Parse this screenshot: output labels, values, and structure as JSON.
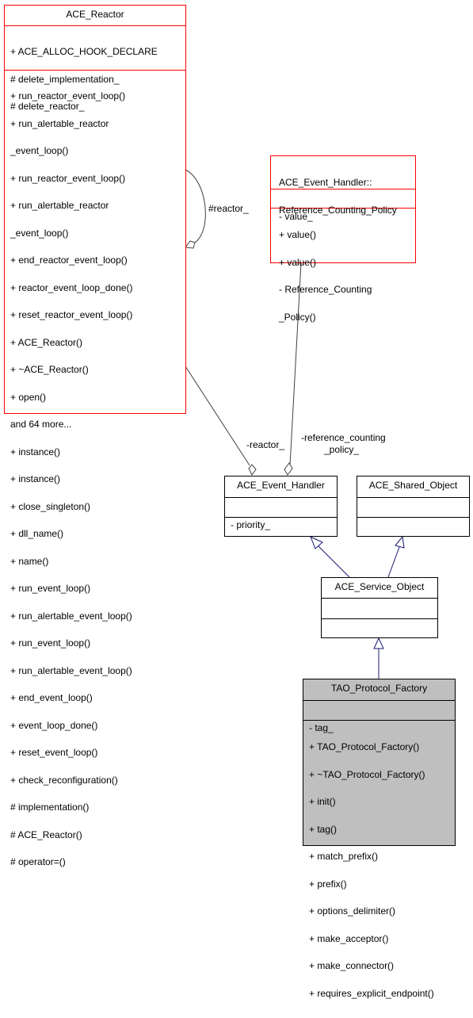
{
  "classes": {
    "ace_reactor": {
      "name": "ACE_Reactor",
      "attributes": [
        "+ ACE_ALLOC_HOOK_DECLARE",
        "# delete_implementation_",
        "# delete_reactor_"
      ],
      "methods": [
        "+ run_reactor_event_loop()",
        "+ run_alertable_reactor",
        "_event_loop()",
        "+ run_reactor_event_loop()",
        "+ run_alertable_reactor",
        "_event_loop()",
        "+ end_reactor_event_loop()",
        "+ reactor_event_loop_done()",
        "+ reset_reactor_event_loop()",
        "+ ACE_Reactor()",
        "+ ~ACE_Reactor()",
        "+ open()",
        "and 64 more...",
        "+ instance()",
        "+ instance()",
        "+ close_singleton()",
        "+ dll_name()",
        "+ name()",
        "+ run_event_loop()",
        "+ run_alertable_event_loop()",
        "+ run_event_loop()",
        "+ run_alertable_event_loop()",
        "+ end_event_loop()",
        "+ event_loop_done()",
        "+ reset_event_loop()",
        "+ check_reconfiguration()",
        "# implementation()",
        "# ACE_Reactor()",
        "# operator=()"
      ]
    },
    "reference_counting_policy": {
      "name_lines": [
        "ACE_Event_Handler::",
        "Reference_Counting_Policy"
      ],
      "attributes": [
        "- value_"
      ],
      "methods": [
        "+ value()",
        "+ value()",
        "- Reference_Counting",
        "_Policy()"
      ]
    },
    "ace_event_handler": {
      "name": "ACE_Event_Handler",
      "attributes": [
        "- priority_"
      ],
      "methods": []
    },
    "ace_shared_object": {
      "name": "ACE_Shared_Object",
      "attributes": [],
      "methods": []
    },
    "ace_service_object": {
      "name": "ACE_Service_Object",
      "attributes": [],
      "methods": []
    },
    "tao_protocol_factory": {
      "name": "TAO_Protocol_Factory",
      "attributes": [
        "- tag_"
      ],
      "methods": [
        "+ TAO_Protocol_Factory()",
        "+ ~TAO_Protocol_Factory()",
        "+ init()",
        "+ tag()",
        "+ match_prefix()",
        "+ prefix()",
        "+ options_delimiter()",
        "+ make_acceptor()",
        "+ make_connector()",
        "+ requires_explicit_endpoint()"
      ]
    }
  },
  "edge_labels": {
    "self_reactor": "#reactor_",
    "reactor": "-reactor_",
    "reference_counting_policy_lines": [
      "-reference_counting",
      "_policy_"
    ]
  },
  "colors": {
    "undocumented_border": "#ff0000",
    "documented_border": "#000000",
    "focus_fill": "#bfbfbf",
    "inheritance_edge": "#191970",
    "usage_edge": "#404040"
  }
}
